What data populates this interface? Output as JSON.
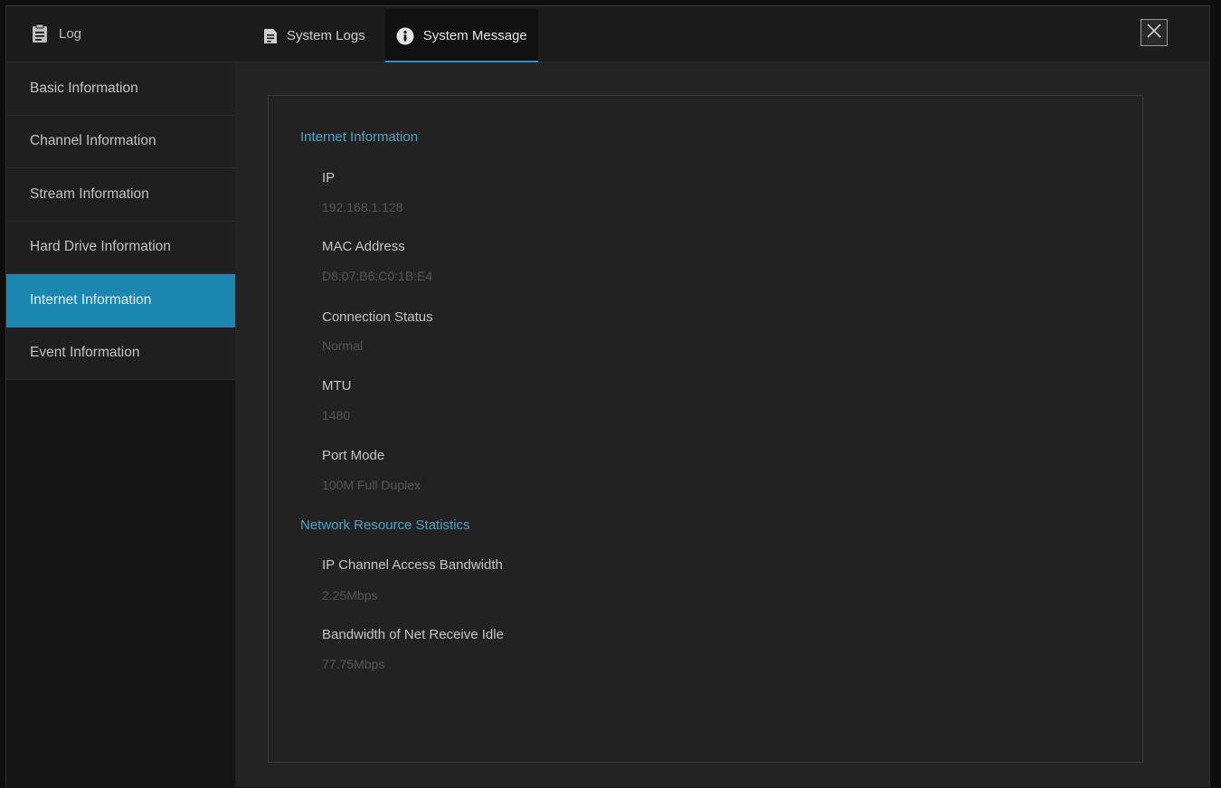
{
  "window": {
    "title": "Log",
    "title_icon": "clipboard-icon",
    "close_icon": "close-icon"
  },
  "tabs": [
    {
      "label": "System Logs",
      "icon": "document-icon",
      "active": false
    },
    {
      "label": "System Message",
      "icon": "info-icon",
      "active": true
    }
  ],
  "sidebar": {
    "items": [
      {
        "label": "Basic Information",
        "active": false
      },
      {
        "label": "Channel Information",
        "active": false
      },
      {
        "label": "Stream Information",
        "active": false
      },
      {
        "label": "Hard Drive Information",
        "active": false
      },
      {
        "label": "Internet Information",
        "active": true
      },
      {
        "label": "Event Information",
        "active": false
      }
    ]
  },
  "internet": {
    "title": "Internet Information",
    "fields": [
      {
        "label": "IP",
        "value": "192.168.1.128"
      },
      {
        "label": "MAC Address",
        "value": "D8:07:B6:C0:1B:E4"
      },
      {
        "label": "Connection Status",
        "value": "Normal"
      },
      {
        "label": "MTU",
        "value": "1480"
      },
      {
        "label": "Port Mode",
        "value": "100M Full Duplex"
      }
    ]
  },
  "network": {
    "title": "Network Resource Statistics",
    "fields": [
      {
        "label": "IP Channel Access Bandwidth",
        "value": "2.25Mbps"
      },
      {
        "label": "Bandwidth of Net Receive Idle",
        "value": "77.75Mbps"
      }
    ]
  },
  "colors": {
    "accent": "#1b87b0",
    "section_title": "#4ba3c8",
    "background": "#232323"
  }
}
